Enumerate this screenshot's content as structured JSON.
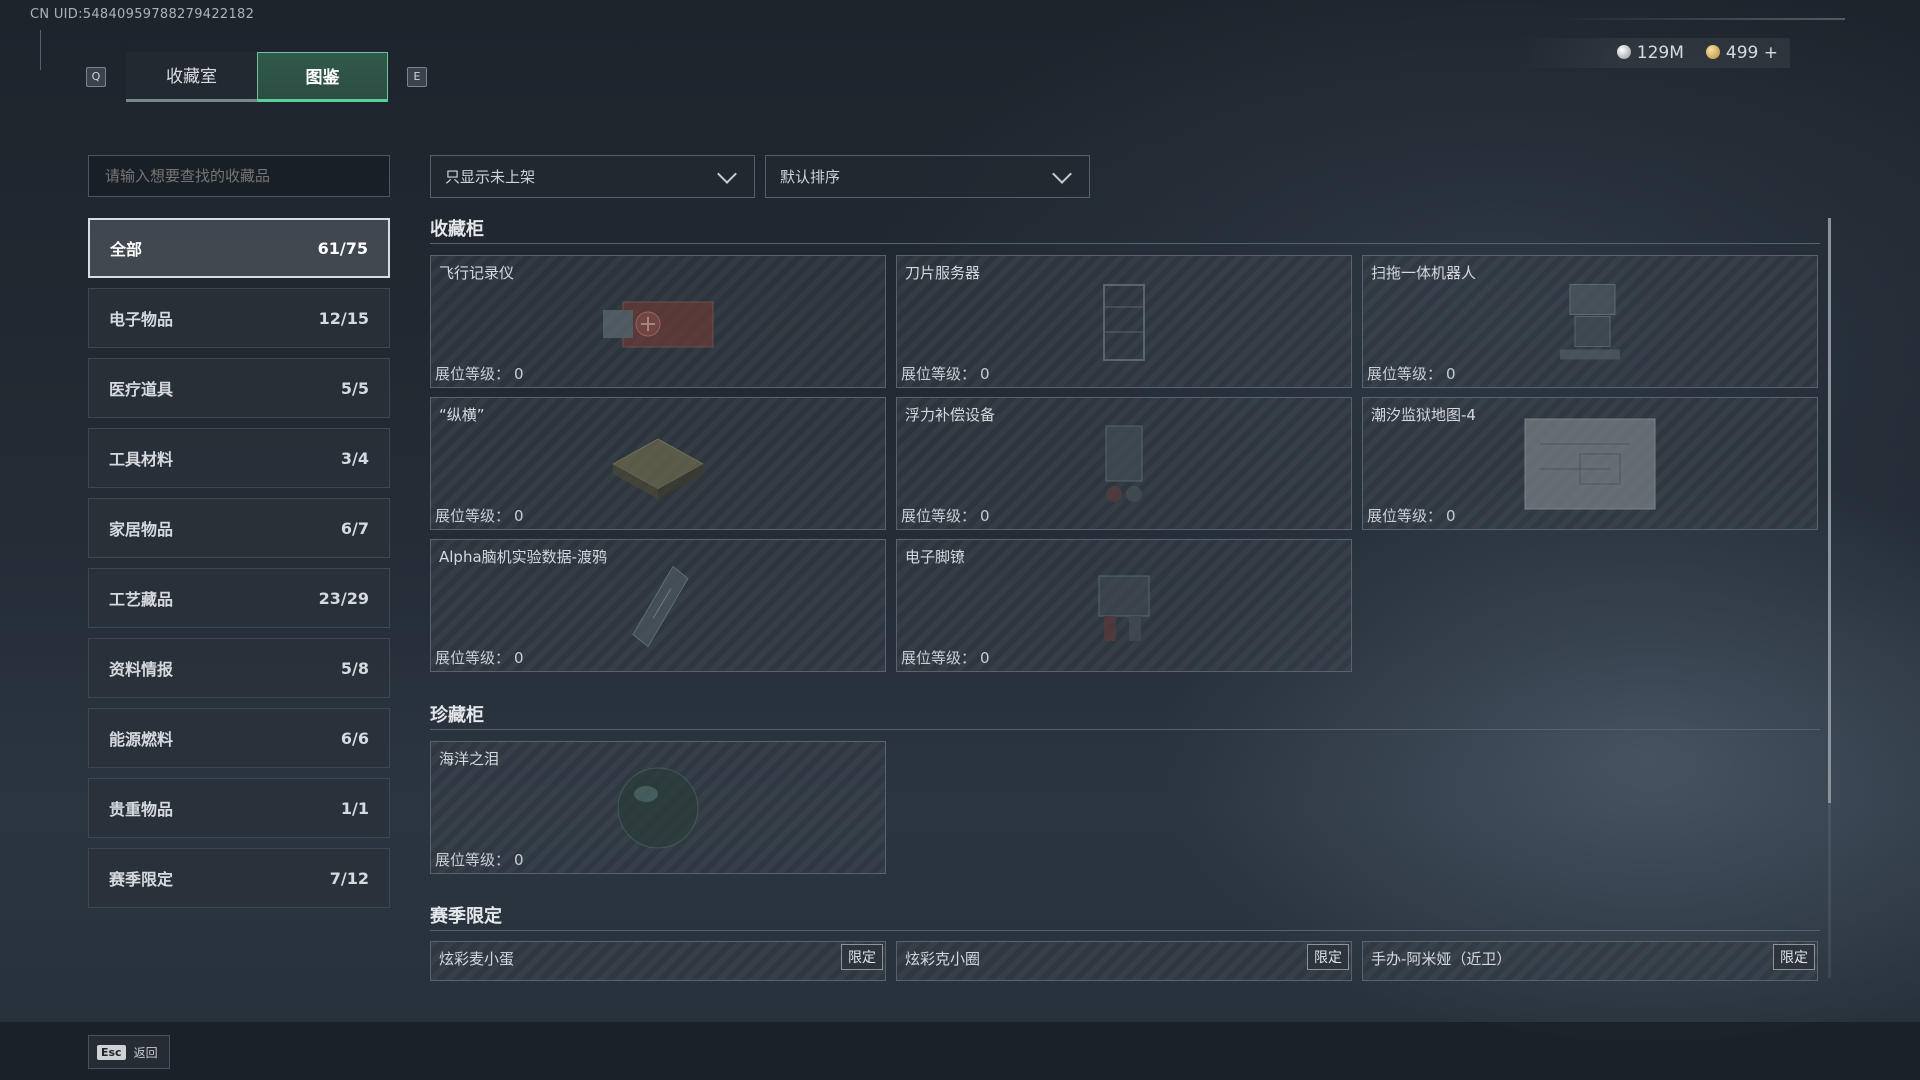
{
  "header": {
    "uid": "CN UID:5484095978827942218​2",
    "tabs": [
      {
        "key": "Q"
      },
      {
        "label": "收藏室"
      },
      {
        "label": "图鉴"
      },
      {
        "key": "E"
      }
    ],
    "currency": [
      {
        "icon": "silver-coin-icon",
        "value": "129M"
      },
      {
        "icon": "gold-coin-icon",
        "value": "499 +"
      }
    ]
  },
  "search": {
    "placeholder": "请输入想要查找的收藏品"
  },
  "filters": {
    "availability": "只显示未上架",
    "sort": "默认排序"
  },
  "categories": [
    {
      "label": "全部",
      "count": "61/75"
    },
    {
      "label": "电子物品",
      "count": "12/15"
    },
    {
      "label": "医疗道具",
      "count": "5/5"
    },
    {
      "label": "工具材料",
      "count": "3/4"
    },
    {
      "label": "家居物品",
      "count": "6/7"
    },
    {
      "label": "工艺藏品",
      "count": "23/29"
    },
    {
      "label": "资料情报",
      "count": "5/8"
    },
    {
      "label": "能源燃料",
      "count": "6/6"
    },
    {
      "label": "贵重物品",
      "count": "1/1"
    },
    {
      "label": "赛季限定",
      "count": "7/12"
    }
  ],
  "level_label": "展位等级：",
  "limited_label": "限定",
  "sections": [
    {
      "title": "收藏柜",
      "items": [
        {
          "name": "飞行记录仪",
          "level": "0"
        },
        {
          "name": "刀片服务器",
          "level": "0"
        },
        {
          "name": "扫拖一体机器人",
          "level": "0"
        },
        {
          "name": "“纵横”",
          "level": "0"
        },
        {
          "name": "浮力补偿设备",
          "level": "0"
        },
        {
          "name": "潮汐监狱地图-4",
          "level": "0"
        },
        {
          "name": "Alpha脑机实验数据-渡鸦",
          "level": "0"
        },
        {
          "name": "电子脚镣",
          "level": "0"
        }
      ]
    },
    {
      "title": "珍藏柜",
      "items": [
        {
          "name": "海洋之泪",
          "level": "0"
        }
      ]
    },
    {
      "title": "赛季限定",
      "items": [
        {
          "name": "炫彩麦小蛋"
        },
        {
          "name": "炫彩克小圈"
        },
        {
          "name": "手办-阿米娅（近卫）"
        }
      ]
    }
  ],
  "footer": {
    "esc_key": "Esc",
    "back_label": "返回"
  }
}
